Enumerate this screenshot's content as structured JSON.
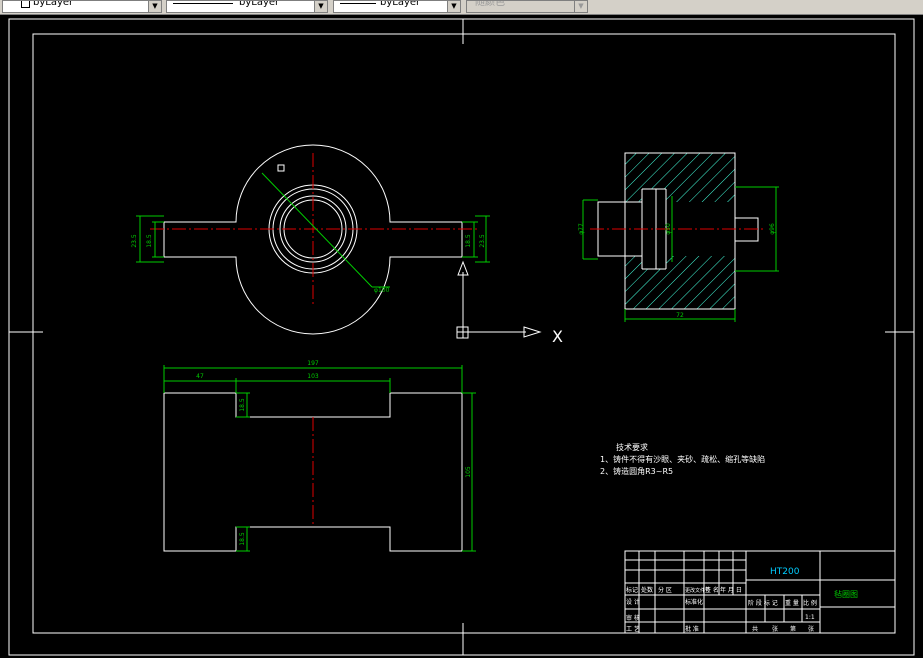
{
  "toolbar": {
    "layer_color": "byLayer",
    "linetype": "byLayer",
    "lineweight": "byLayer",
    "plot_style": "随颜色"
  },
  "drawing": {
    "dimensions": {
      "top_left_outer": "23.5",
      "top_left_inner": "18.5",
      "top_right_inner": "18.5",
      "top_right_outer": "23.5",
      "diameter_100": "φ100",
      "side_left": "φ77",
      "side_mid": "φ50",
      "side_right": "φ96",
      "side_bottom": "72",
      "front_total": "197",
      "front_left": "47",
      "front_mid": "103",
      "front_notch_top": "18.5",
      "front_notch_bottom": "18.5",
      "front_height": "105"
    },
    "ucs_label": "X",
    "tech_req": {
      "title": "技术要求",
      "line1": "1、铸件不得有沙眼、夹砂、疏松、缩孔等缺陷",
      "line2": "2、铸造圆角R3~R5"
    }
  },
  "title_block": {
    "material": "HT200",
    "part_name": "毡圈图",
    "scale": "1:1",
    "h_mark": "标记",
    "h_count": "处数",
    "h_zone": "分 区",
    "h_docno": "更改文件号",
    "h_sign": "签 名",
    "h_date": "年 月 日",
    "r_design": "设 计",
    "r_std": "标准化",
    "r_review": "审 核",
    "r_process": "工 艺",
    "r_approve": "批 准",
    "h_stage": "阶 段 标 记",
    "h_weight": "重 量",
    "h_ratio": "比 例",
    "total": "共",
    "sheet": "张",
    "page": "第",
    "sheet2": "张"
  }
}
